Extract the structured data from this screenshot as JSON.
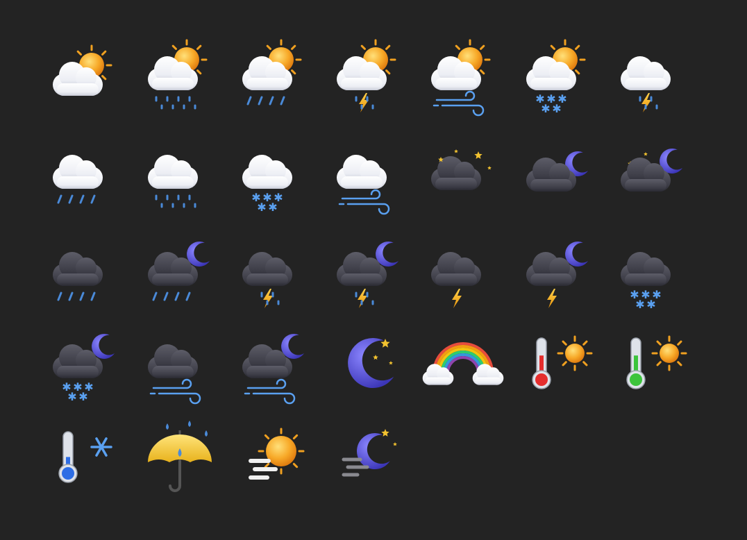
{
  "icon_rows": [
    [
      "partly-cloudy-day-icon",
      "partly-cloudy-day-rain-icon",
      "partly-cloudy-day-showers-icon",
      "partly-cloudy-day-thunderstorm-icon",
      "partly-cloudy-day-windy-icon",
      "partly-cloudy-day-snow-icon",
      "cloudy-thunderstorm-icon"
    ],
    [
      "cloudy-showers-icon",
      "cloudy-rain-icon",
      "cloudy-snow-icon",
      "cloudy-windy-icon",
      "dark-cloud-stars-icon",
      "cloudy-night-icon",
      "cloudy-night-stars-icon"
    ],
    [
      "dark-cloud-showers-icon",
      "night-showers-icon",
      "dark-cloud-thunderstorm-rain-icon",
      "night-thunderstorm-rain-icon",
      "dark-cloud-thunder-icon",
      "night-thunder-icon",
      "dark-cloud-snow-icon"
    ],
    [
      "night-snow-icon",
      "dark-cloud-windy-icon",
      "night-windy-icon",
      "crescent-moon-stars-icon",
      "rainbow-icon",
      "thermometer-hot-sun-icon",
      "thermometer-warm-sun-icon"
    ],
    [
      "thermometer-cold-snowflake-icon",
      "umbrella-rain-icon",
      "sun-fog-icon",
      "moon-fog-icon"
    ]
  ],
  "colors": {
    "background": "#232323",
    "sun": "#f5a623",
    "sun_ray": "#f0a020",
    "cloud_white": "#f4f4f6",
    "cloud_dark": "#4a4a55",
    "rain": "#4a8ad8",
    "snow": "#5aa0f0",
    "lightning": "#f2b01e",
    "moon": "#5a55d6",
    "star": "#f2c230"
  }
}
